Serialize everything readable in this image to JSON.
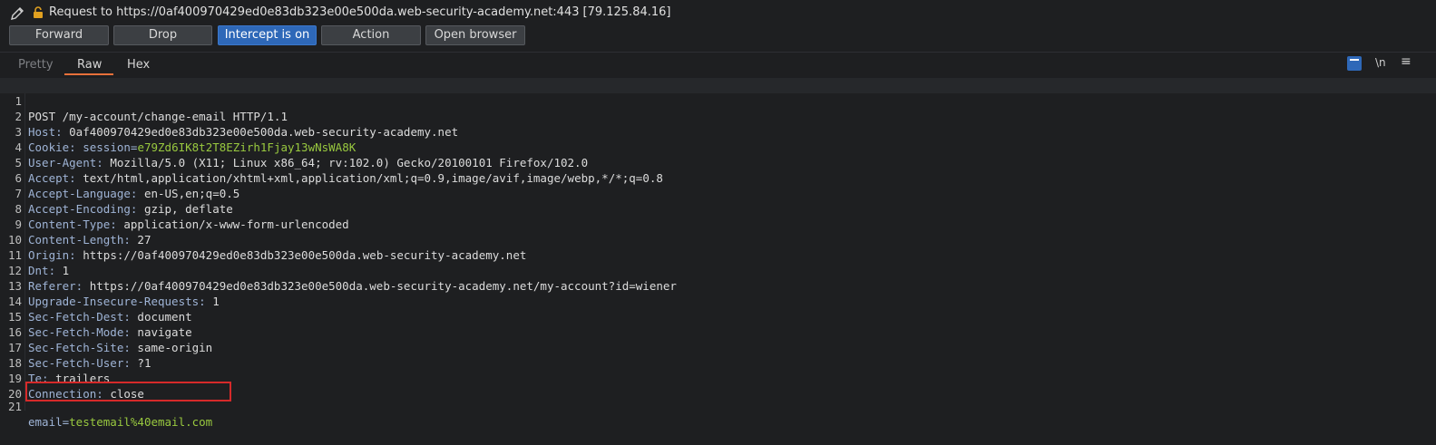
{
  "header": {
    "request_prefix": "Request to https://0af400970429ed0e83db323e00e500da.web-security-academy.net:443",
    "ip": "[79.125.84.16]"
  },
  "toolbar": {
    "forward": "Forward",
    "drop": "Drop",
    "intercept": "Intercept is on",
    "action": "Action",
    "open_browser": "Open browser"
  },
  "tabs": {
    "pretty": "Pretty",
    "raw": "Raw",
    "hex": "Hex"
  },
  "editor_tools": {
    "newline": "\\n",
    "menu": "≡"
  },
  "lines": [
    {
      "n": "1",
      "text": "POST /my-account/change-email HTTP/1.1"
    },
    {
      "n": "2",
      "key": "Host: ",
      "val": "0af400970429ed0e83db323e00e500da.web-security-academy.net"
    },
    {
      "n": "3",
      "key": "Cookie: ",
      "sub": "session=",
      "val": "e79Zd6IK8t2T8EZirh1Fjay13wNsWA8K"
    },
    {
      "n": "4",
      "key": "User-Agent: ",
      "val": "Mozilla/5.0 (X11; Linux x86_64; rv:102.0) Gecko/20100101 Firefox/102.0"
    },
    {
      "n": "5",
      "key": "Accept: ",
      "val": "text/html,application/xhtml+xml,application/xml;q=0.9,image/avif,image/webp,*/*;q=0.8"
    },
    {
      "n": "6",
      "key": "Accept-Language: ",
      "val": "en-US,en;q=0.5"
    },
    {
      "n": "7",
      "key": "Accept-Encoding: ",
      "val": "gzip, deflate"
    },
    {
      "n": "8",
      "key": "Content-Type: ",
      "val": "application/x-www-form-urlencoded"
    },
    {
      "n": "9",
      "key": "Content-Length: ",
      "val": "27"
    },
    {
      "n": "10",
      "key": "Origin: ",
      "val": "https://0af400970429ed0e83db323e00e500da.web-security-academy.net"
    },
    {
      "n": "11",
      "key": "Dnt: ",
      "val": "1"
    },
    {
      "n": "12",
      "key": "Referer: ",
      "val": "https://0af400970429ed0e83db323e00e500da.web-security-academy.net/my-account?id=wiener"
    },
    {
      "n": "13",
      "key": "Upgrade-Insecure-Requests: ",
      "val": "1"
    },
    {
      "n": "14",
      "key": "Sec-Fetch-Dest: ",
      "val": "document"
    },
    {
      "n": "15",
      "key": "Sec-Fetch-Mode: ",
      "val": "navigate"
    },
    {
      "n": "16",
      "key": "Sec-Fetch-Site: ",
      "val": "same-origin"
    },
    {
      "n": "17",
      "key": "Sec-Fetch-User: ",
      "val": "?1"
    },
    {
      "n": "18",
      "key": "Te: ",
      "val": "trailers"
    },
    {
      "n": "19",
      "key": "Connection: ",
      "val": "close"
    },
    {
      "n": "20",
      "text": ""
    },
    {
      "n": "21",
      "key": "email=",
      "val": "testemail%40email.com"
    }
  ]
}
